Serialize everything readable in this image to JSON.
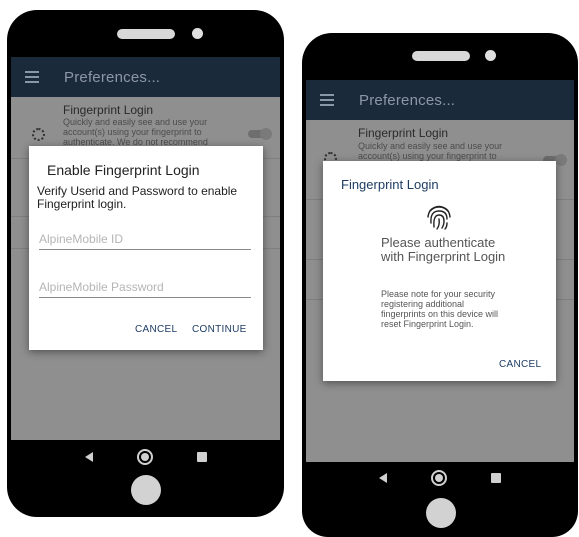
{
  "left": {
    "appbar": {
      "title": "Preferences..."
    },
    "pref": {
      "fingerprint_title": "Fingerprint Login",
      "fingerprint_sub": "Quickly and easily see and use your account(s) using your fingerprint to authenticate. We do not recommend"
    },
    "dialog": {
      "title": "Enable Fingerprint Login",
      "message": "Verify Userid and Password to enable Fingerprint login.",
      "id_placeholder": "AlpineMobile ID",
      "password_placeholder": "AlpineMobile Password",
      "cancel_label": "CANCEL",
      "continue_label": "CONTINUE"
    }
  },
  "right": {
    "appbar": {
      "title": "Preferences..."
    },
    "pref": {
      "fingerprint_title": "Fingerprint Login",
      "fingerprint_sub": "Quickly and easily see and use your account(s) using your fingerprint to"
    },
    "dialog": {
      "title": "Fingerprint Login",
      "message": "Please authenticate with Fingerprint Login",
      "note": "Please note for your security registering additional fingerprints on this device will reset Fingerprint Login.",
      "cancel_label": "CANCEL"
    }
  },
  "colors": {
    "appbar": "#1b2a3a",
    "accent": "#1e3d63",
    "phone_body": "#000000"
  }
}
